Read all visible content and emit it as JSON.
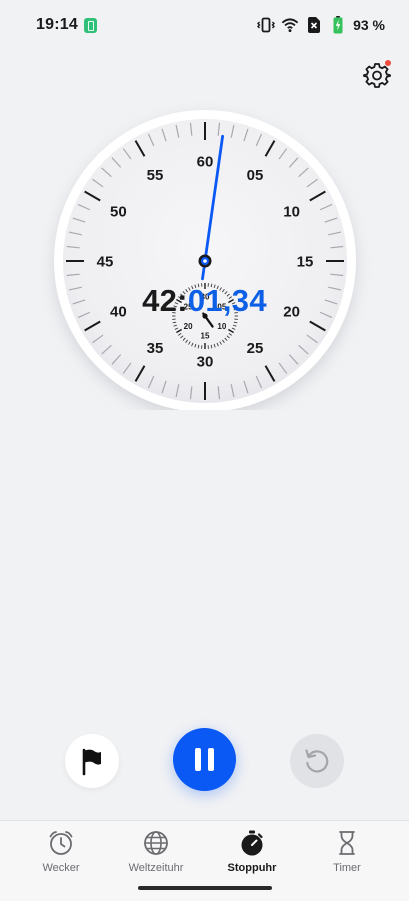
{
  "status_bar": {
    "time": "19:14",
    "battery_percent": "93 %",
    "icons": [
      "app-notification-icon",
      "vibrate-icon",
      "wifi-icon",
      "no-sim-icon",
      "battery-charging-icon"
    ]
  },
  "header": {
    "settings_icon": "gear-icon",
    "settings_has_badge": true
  },
  "stopwatch": {
    "minutes": "42:",
    "seconds": "01,34",
    "dial_numbers": [
      "60",
      "05",
      "10",
      "15",
      "20",
      "25",
      "30",
      "35",
      "40",
      "45",
      "50",
      "55"
    ],
    "subdial_numbers": [
      "30",
      "05",
      "10",
      "15",
      "20",
      "25"
    ],
    "second_hand_seconds": 1.34,
    "minute_subdial_minutes": 42
  },
  "controls": {
    "lap_icon": "flag-icon",
    "pause_icon": "pause-icon",
    "reset_icon": "reset-icon"
  },
  "bottom_nav": {
    "items": [
      {
        "label": "Wecker",
        "icon": "alarm-clock-icon",
        "active": false
      },
      {
        "label": "Weltzeituhr",
        "icon": "globe-icon",
        "active": false
      },
      {
        "label": "Stoppuhr",
        "icon": "stopwatch-icon",
        "active": true
      },
      {
        "label": "Timer",
        "icon": "hourglass-icon",
        "active": false
      }
    ]
  },
  "colors": {
    "accent": "#0a59f5",
    "readout_seconds": "#0d60e6",
    "background": "#f1f2f4",
    "badge": "#f24b3f"
  }
}
